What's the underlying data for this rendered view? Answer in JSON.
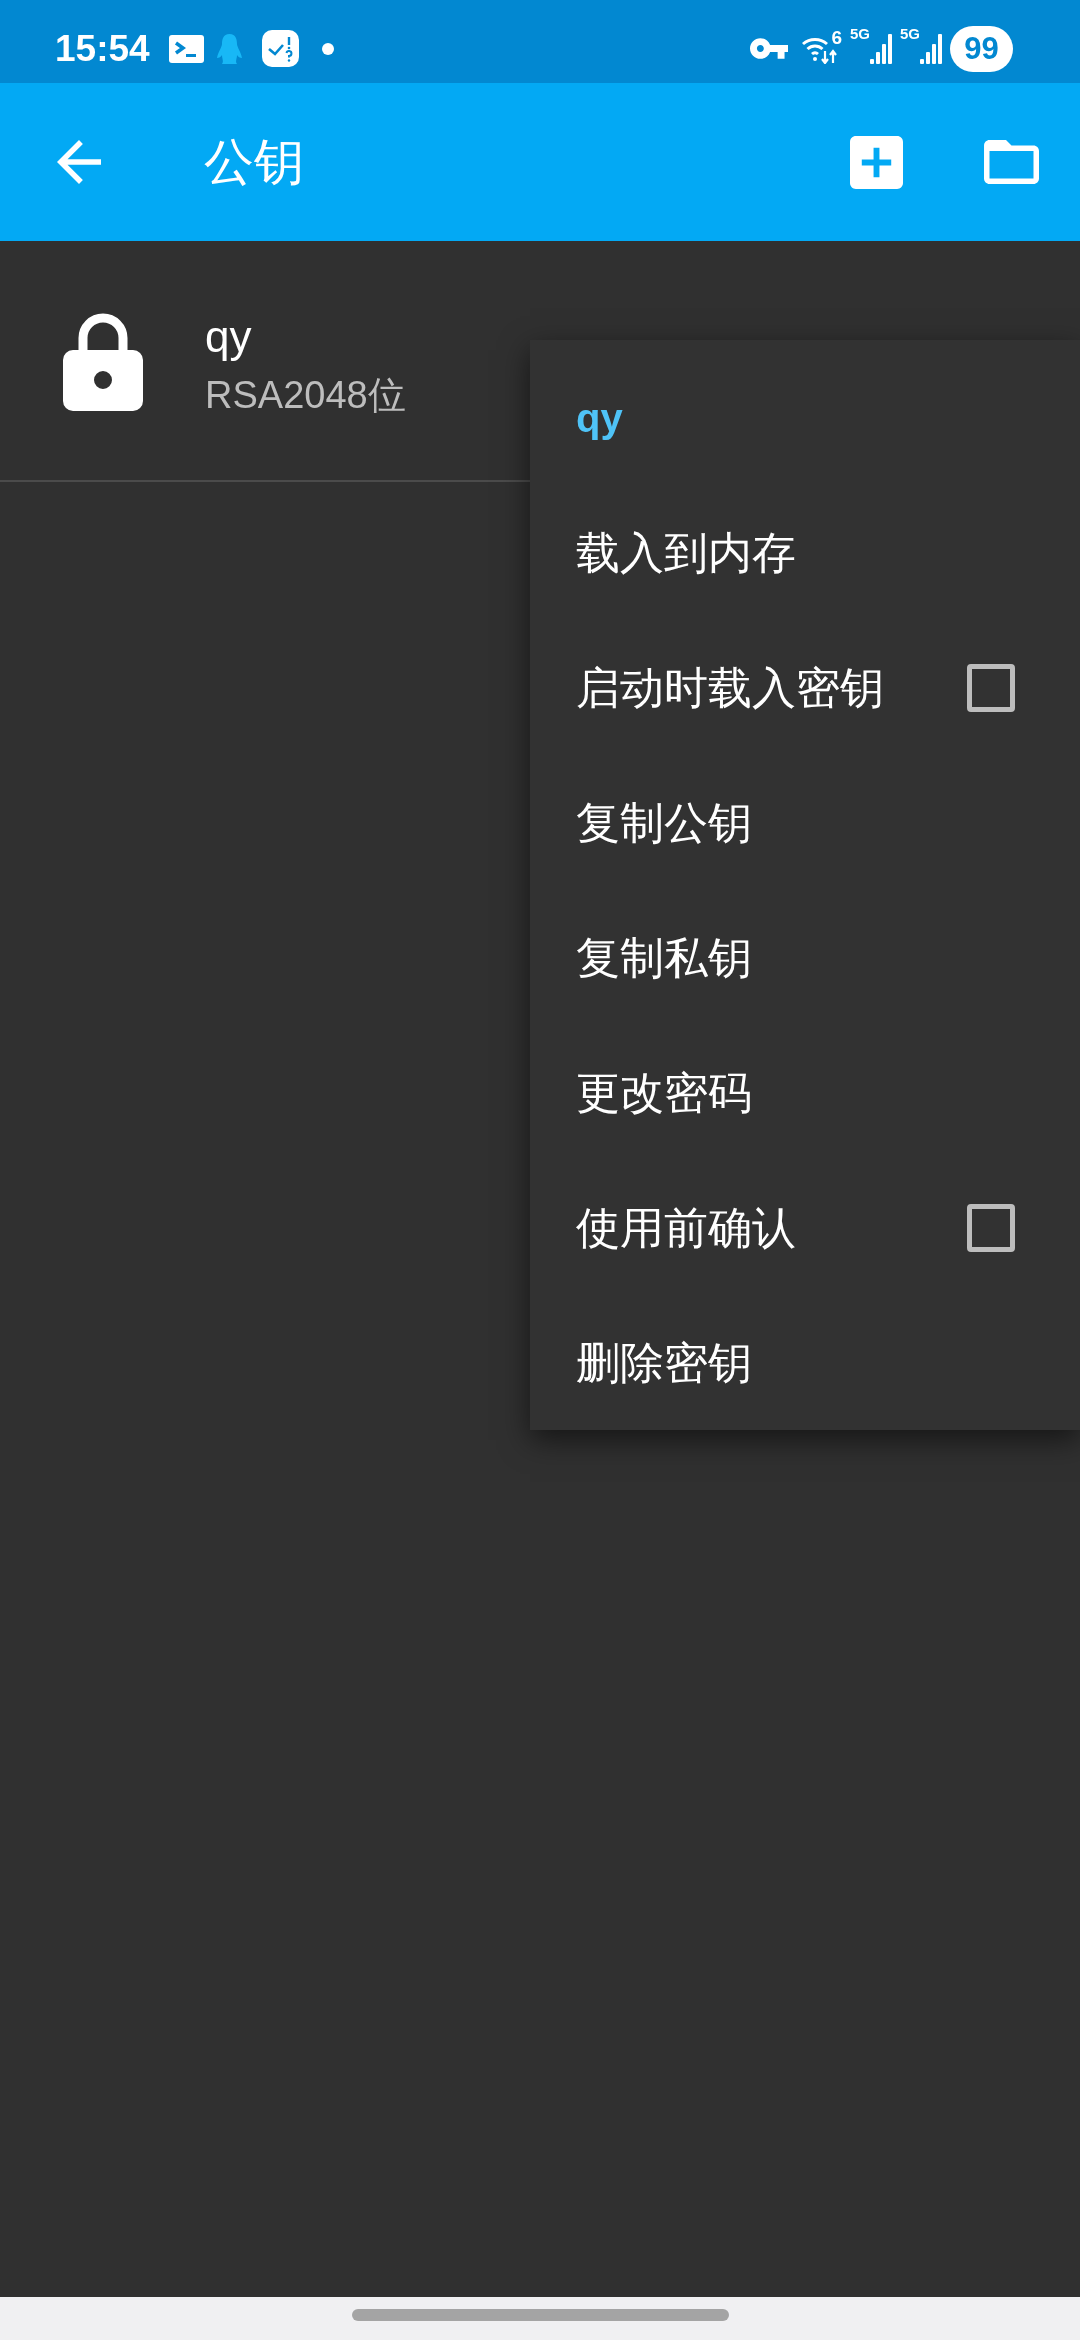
{
  "status_bar": {
    "time": "15:54",
    "wifi": {
      "label": "6"
    },
    "signals": [
      {
        "label": "5G"
      },
      {
        "label": "5G"
      }
    ],
    "battery": "99"
  },
  "app_bar": {
    "title": "公钥"
  },
  "keys": [
    {
      "name": "qy",
      "detail": "RSA2048位",
      "locked": true
    }
  ],
  "context_menu": {
    "title": "qy",
    "items": [
      {
        "kind": "action",
        "label": "载入到内存"
      },
      {
        "kind": "checkbox",
        "label": "启动时载入密钥",
        "checked": false
      },
      {
        "kind": "action",
        "label": "复制公钥"
      },
      {
        "kind": "action",
        "label": "复制私钥"
      },
      {
        "kind": "action",
        "label": "更改密码"
      },
      {
        "kind": "checkbox",
        "label": "使用前确认",
        "checked": false
      },
      {
        "kind": "action",
        "label": "删除密钥"
      }
    ]
  }
}
